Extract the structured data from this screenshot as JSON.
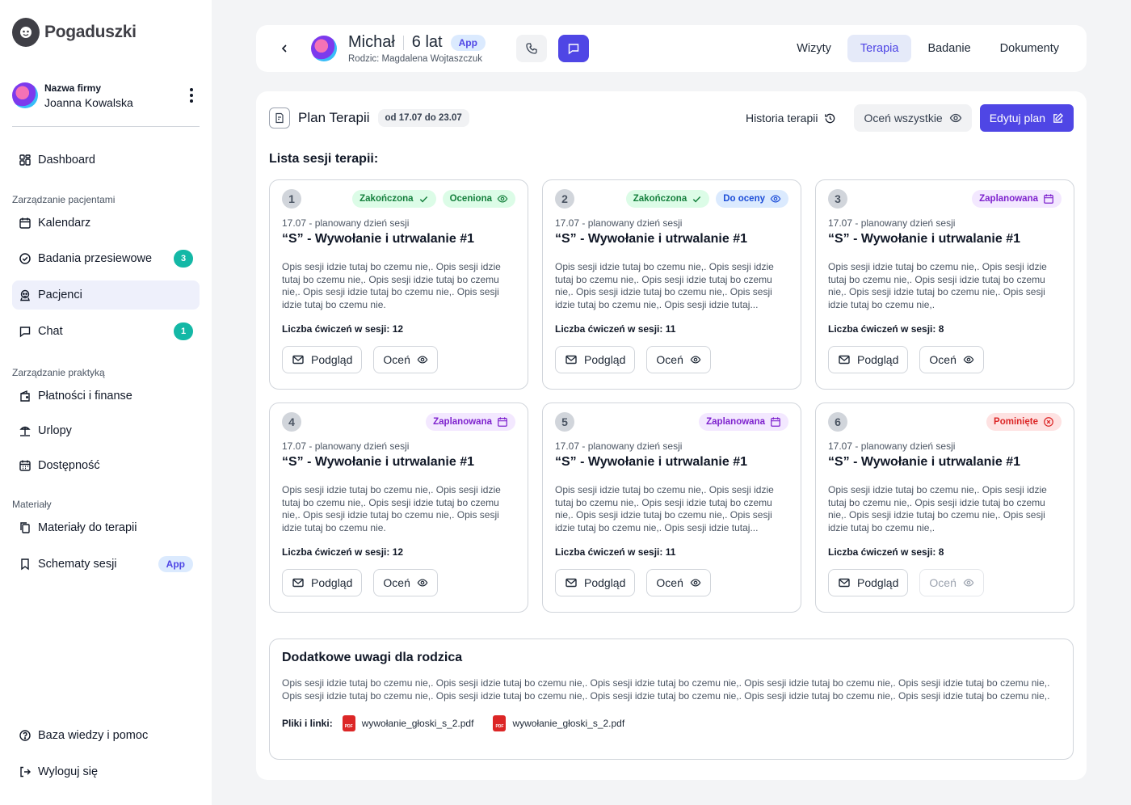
{
  "app": {
    "name": "Pogaduszki"
  },
  "user": {
    "company": "Nazwa firmy",
    "name": "Joanna Kowalska"
  },
  "nav": {
    "dashboard": "Dashboard",
    "section_patients": "Zarządzanie pacjentami",
    "calendar": "Kalendarz",
    "screening": "Badania przesiewowe",
    "screening_badge": "3",
    "patients": "Pacjenci",
    "chat": "Chat",
    "chat_badge": "1",
    "section_practice": "Zarządzanie praktyką",
    "payments": "Płatności i finanse",
    "holidays": "Urlopy",
    "availability": "Dostępność",
    "section_materials": "Materiały",
    "materials": "Materiały do terapii",
    "schemes": "Schematy sesji",
    "schemes_badge": "App",
    "help": "Baza wiedzy i pomoc",
    "logout": "Wyloguj się"
  },
  "header": {
    "patient_name": "Michał",
    "patient_age": "6 lat",
    "app_badge": "App",
    "parent": "Rodzic: Magdalena Wojtaszczuk",
    "tabs": [
      "Wizyty",
      "Terapia",
      "Badanie",
      "Dokumenty"
    ],
    "active_tab": "Terapia"
  },
  "plan": {
    "title": "Plan Terapii",
    "range": "od 17.07 do 23.07",
    "history": "Historia terapii",
    "rate_all": "Oceń wszystkie",
    "edit": "Edytuj plan",
    "list_title": "Lista sesji terapii:"
  },
  "sessions": [
    {
      "number": "1",
      "date": "17.07 - planowany dzień sesji",
      "title": "“S” - Wywołanie i utrwalanie #1",
      "description": "Opis sesji idzie tutaj bo czemu nie,. Opis sesji idzie tutaj bo czemu nie,. Opis sesji idzie tutaj bo czemu nie,. Opis sesji idzie tutaj bo czemu nie,. Opis sesji idzie tutaj bo czemu nie.",
      "count": "Liczba ćwiczeń w sesji: 12",
      "statuses": [
        {
          "label": "Zakończona",
          "color": "green",
          "icon": "check-icon"
        },
        {
          "label": "Oceniona",
          "color": "green",
          "icon": "eye-icon"
        }
      ],
      "preview": "Podgląd",
      "rate": "Oceń",
      "rate_disabled": false
    },
    {
      "number": "2",
      "date": "17.07 - planowany dzień sesji",
      "title": "“S” - Wywołanie i utrwalanie #1",
      "description": "Opis sesji idzie tutaj bo czemu nie,. Opis sesji idzie tutaj bo czemu nie,. Opis sesji idzie tutaj bo czemu nie,. Opis sesji idzie tutaj bo czemu nie,. Opis sesji idzie tutaj bo czemu nie,. Opis sesji idzie tutaj...",
      "count": "Liczba ćwiczeń w sesji: 11",
      "statuses": [
        {
          "label": "Zakończona",
          "color": "green",
          "icon": "check-icon"
        },
        {
          "label": "Do oceny",
          "color": "blue",
          "icon": "eye-icon"
        }
      ],
      "preview": "Podgląd",
      "rate": "Oceń",
      "rate_disabled": false
    },
    {
      "number": "3",
      "date": "17.07 - planowany dzień sesji",
      "title": "“S” - Wywołanie i utrwalanie #1",
      "description": "Opis sesji idzie tutaj bo czemu nie,. Opis sesji idzie tutaj bo czemu nie,. Opis sesji idzie tutaj bo czemu nie,. Opis sesji idzie tutaj bo czemu nie,. Opis sesji idzie tutaj bo czemu nie,.",
      "count": "Liczba ćwiczeń w sesji: 8",
      "statuses": [
        {
          "label": "Zaplanowana",
          "color": "purple",
          "icon": "calendar-icon"
        }
      ],
      "preview": "Podgląd",
      "rate": "Oceń",
      "rate_disabled": false
    },
    {
      "number": "4",
      "date": "17.07 - planowany dzień sesji",
      "title": "“S” - Wywołanie i utrwalanie #1",
      "description": "Opis sesji idzie tutaj bo czemu nie,. Opis sesji idzie tutaj bo czemu nie,. Opis sesji idzie tutaj bo czemu nie,. Opis sesji idzie tutaj bo czemu nie,. Opis sesji idzie tutaj bo czemu nie.",
      "count": "Liczba ćwiczeń w sesji: 12",
      "statuses": [
        {
          "label": "Zaplanowana",
          "color": "purple",
          "icon": "calendar-icon"
        }
      ],
      "preview": "Podgląd",
      "rate": "Oceń",
      "rate_disabled": false
    },
    {
      "number": "5",
      "date": "17.07 - planowany dzień sesji",
      "title": "“S” - Wywołanie i utrwalanie #1",
      "description": "Opis sesji idzie tutaj bo czemu nie,. Opis sesji idzie tutaj bo czemu nie,. Opis sesji idzie tutaj bo czemu nie,. Opis sesji idzie tutaj bo czemu nie,. Opis sesji idzie tutaj bo czemu nie,. Opis sesji idzie tutaj...",
      "count": "Liczba ćwiczeń w sesji: 11",
      "statuses": [
        {
          "label": "Zaplanowana",
          "color": "purple",
          "icon": "calendar-icon"
        }
      ],
      "preview": "Podgląd",
      "rate": "Oceń",
      "rate_disabled": false
    },
    {
      "number": "6",
      "date": "17.07 - planowany dzień sesji",
      "title": "“S” - Wywołanie i utrwalanie #1",
      "description": "Opis sesji idzie tutaj bo czemu nie,. Opis sesji idzie tutaj bo czemu nie,. Opis sesji idzie tutaj bo czemu nie,. Opis sesji idzie tutaj bo czemu nie,. Opis sesji idzie tutaj bo czemu nie,.",
      "count": "Liczba ćwiczeń w sesji: 8",
      "statuses": [
        {
          "label": "Pominięte",
          "color": "red",
          "icon": "x-circle-icon"
        }
      ],
      "preview": "Podgląd",
      "rate": "Oceń",
      "rate_disabled": true
    }
  ],
  "notes": {
    "title": "Dodatkowe uwagi dla rodzica",
    "text": "Opis sesji idzie tutaj bo czemu nie,. Opis sesji idzie tutaj bo czemu nie,. Opis sesji idzie tutaj bo czemu nie,. Opis sesji idzie tutaj bo czemu nie,. Opis sesji idzie tutaj bo czemu nie,. Opis sesji idzie tutaj bo czemu nie,. Opis sesji idzie tutaj bo czemu nie,. Opis sesji idzie tutaj bo czemu nie,. Opis sesji idzie tutaj bo czemu nie,. Opis sesji idzie tutaj bo czemu nie,.",
    "files_label": "Pliki i linki:",
    "files": [
      "wywołanie_głoski_s_2.pdf",
      "wywołanie_głoski_s_2.pdf"
    ],
    "pdf_tag": "PDF"
  },
  "colors": {
    "accent": "#4f46e5",
    "teal": "#14b8a6",
    "active_nav": "#eef0fb"
  }
}
